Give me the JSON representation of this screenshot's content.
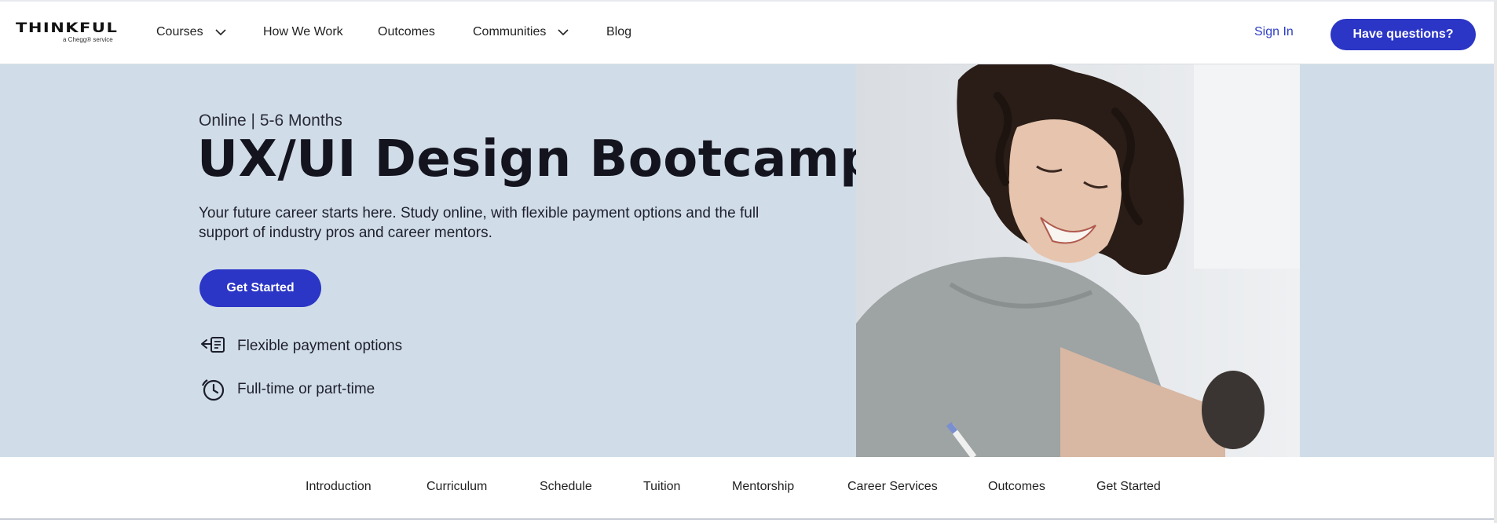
{
  "header": {
    "logo": {
      "word": "THINKFUL",
      "sub": "a Chegg® service"
    },
    "nav": [
      {
        "label": "Courses",
        "dropdown": true
      },
      {
        "label": "How We Work",
        "dropdown": false
      },
      {
        "label": "Outcomes",
        "dropdown": false
      },
      {
        "label": "Communities",
        "dropdown": true
      },
      {
        "label": "Blog",
        "dropdown": false
      }
    ],
    "sign_in": "Sign In",
    "cta": "Have questions?"
  },
  "hero": {
    "kicker": "Online | 5-6 Months",
    "title": "UX/UI Design Bootcamp",
    "description": "Your future career starts here. Study online, with flexible payment options and the full support of industry pros and career mentors.",
    "button": "Get Started",
    "features": [
      {
        "icon": "payment-hand-icon",
        "label": "Flexible payment options"
      },
      {
        "icon": "clock-timer-icon",
        "label": "Full-time or part-time"
      }
    ]
  },
  "subnav": {
    "items": [
      "Introduction",
      "Curriculum",
      "Schedule",
      "Tuition",
      "Mentorship",
      "Career Services",
      "Outcomes",
      "Get Started"
    ]
  },
  "colors": {
    "accent": "#2b35c6",
    "hero_bg": "#d0dde8",
    "link": "#2d3fc2"
  }
}
